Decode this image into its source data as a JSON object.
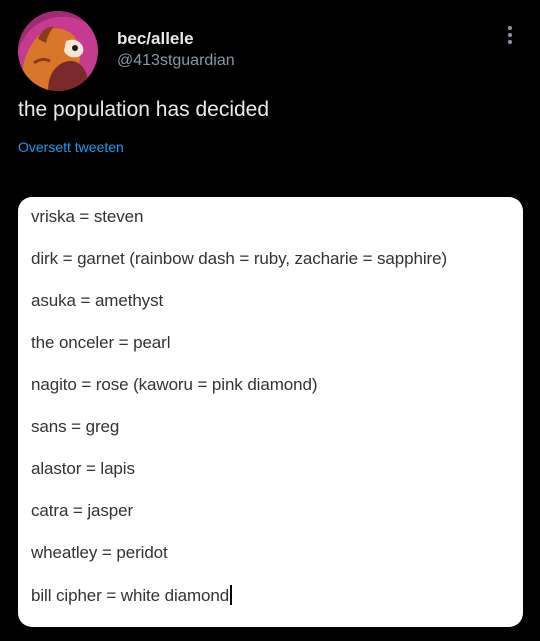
{
  "tweet": {
    "display_name": "bec/allele",
    "handle": "@413stguardian",
    "text": "the population has decided",
    "translate_label": "Oversett tweeten",
    "avatar_icon": "avatar-icon",
    "more_icon": "more-options-icon"
  },
  "media": {
    "lines": [
      "vriska = steven",
      "dirk = garnet (rainbow dash = ruby, zacharie = sapphire)",
      "asuka = amethyst",
      "the onceler = pearl",
      "nagito = rose (kaworu = pink diamond)",
      "sans = greg",
      "alastor = lapis",
      "catra = jasper",
      "wheatley = peridot",
      "bill cipher = white diamond"
    ]
  },
  "colors": {
    "background": "#000000",
    "primary_text": "#e7e9ea",
    "secondary_text": "#8b98a5",
    "link": "#1d9bf0",
    "media_background": "#ffffff",
    "media_text": "#333333"
  }
}
